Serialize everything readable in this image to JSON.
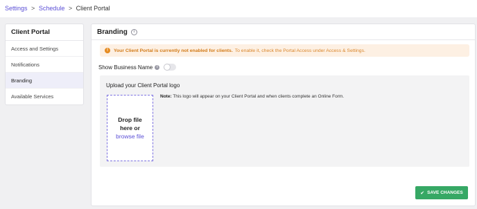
{
  "breadcrumb": {
    "items": [
      "Settings",
      "Schedule",
      "Client Portal"
    ],
    "separator": ">"
  },
  "sidebar": {
    "title": "Client Portal",
    "items": [
      {
        "label": "Access and Settings"
      },
      {
        "label": "Notifications"
      },
      {
        "label": "Branding"
      },
      {
        "label": "Available Services"
      }
    ]
  },
  "main": {
    "title": "Branding",
    "info_icon": "i",
    "warning": {
      "icon": "!",
      "bold_text": "Your Client Portal is currently not enabled for clients.",
      "rest_text": "To enable it, check the Portal Access under Access & Settings."
    },
    "toggle": {
      "label": "Show Business Name",
      "info_icon": "i",
      "enabled": false
    },
    "upload": {
      "title": "Upload your Client Portal logo",
      "drop_line1": "Drop file",
      "drop_line2": "here or",
      "browse_link": "browse file",
      "note_label": "Note:",
      "note_text": "This logo will appear on your Client Portal and when clients complete an Online Form."
    },
    "save_button": {
      "icon": "✔",
      "label": "SAVE CHANGES"
    }
  },
  "colors": {
    "accent": "#5b4fd6",
    "success": "#36a865",
    "warning_bg": "#fdf0e3",
    "warning_text": "#d27a17"
  }
}
